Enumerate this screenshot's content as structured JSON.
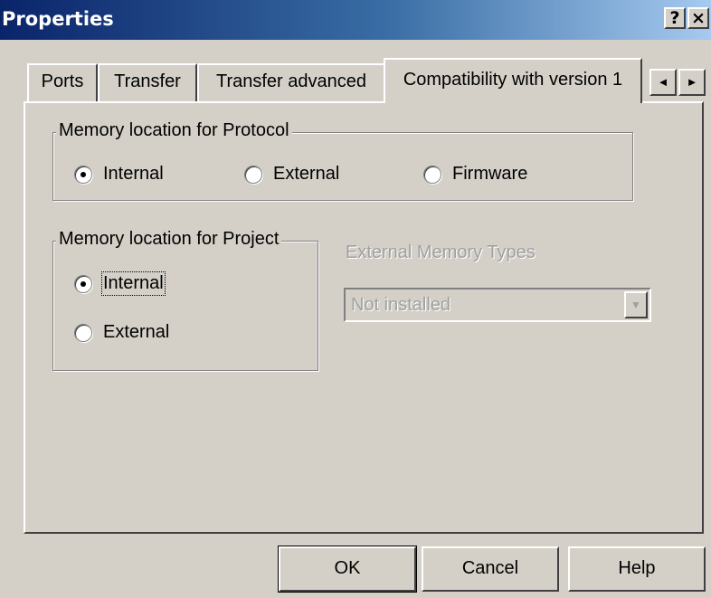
{
  "window": {
    "title": "Properties",
    "help_button": "?",
    "close_button": "×"
  },
  "tabs": [
    {
      "label": "Ports"
    },
    {
      "label": "Transfer"
    },
    {
      "label": "Transfer advanced"
    },
    {
      "label": "Compatibility with version 1",
      "selected": true
    }
  ],
  "tab_scroll": {
    "left": "◄",
    "right": "►"
  },
  "protocol_group": {
    "title": "Memory location for Protocol",
    "options": [
      {
        "label": "Internal",
        "checked": true
      },
      {
        "label": "External",
        "checked": false
      },
      {
        "label": "Firmware",
        "checked": false
      }
    ]
  },
  "project_group": {
    "title": "Memory location for Project",
    "options": [
      {
        "label": "Internal",
        "checked": true
      },
      {
        "label": "External",
        "checked": false
      }
    ]
  },
  "external_memory": {
    "label": "External Memory Types",
    "value": "Not installed",
    "enabled": false
  },
  "buttons": {
    "ok": "OK",
    "cancel": "Cancel",
    "help": "Help"
  },
  "colors": {
    "title_bar_start": "#0a246a",
    "title_bar_end": "#a6caf0",
    "dialog_face": "#d4d0c8",
    "disabled_text": "#a0a0a0"
  }
}
